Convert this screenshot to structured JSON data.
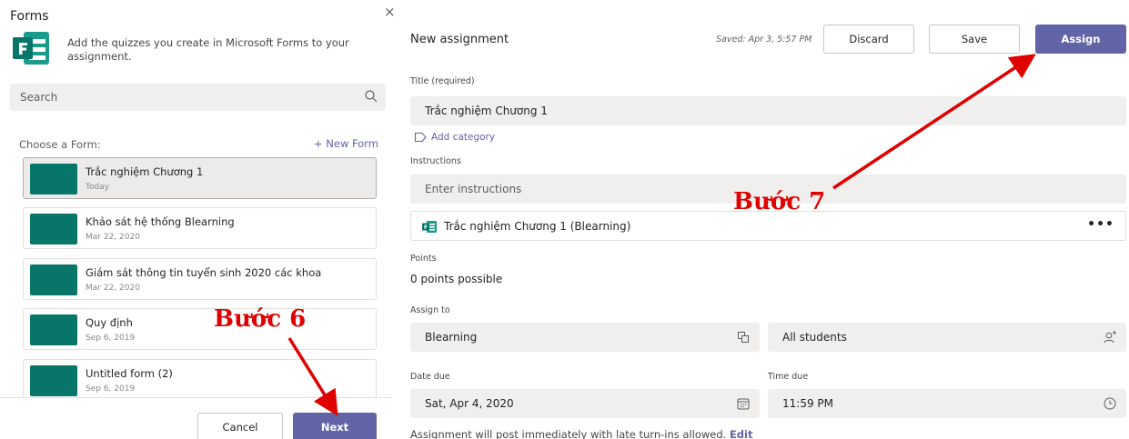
{
  "forms_panel": {
    "title": "Forms",
    "close_glyph": "×",
    "logo_icon": "microsoft-forms-icon",
    "description": "Add the quizzes you create in Microsoft Forms to your assignment.",
    "search": {
      "placeholder": "Search",
      "icon": "search-icon"
    },
    "choose_label": "Choose a Form:",
    "new_form_label": "+ New Form",
    "forms": [
      {
        "name": "Trắc nghiệm Chương 1",
        "date": "Today",
        "selected": true
      },
      {
        "name": "Khảo sát hệ thống Blearning",
        "date": "Mar 22, 2020",
        "selected": false
      },
      {
        "name": "Giám sát thông tin tuyển sinh 2020 các khoa",
        "date": "Mar 22, 2020",
        "selected": false
      },
      {
        "name": "Quy định",
        "date": "Sep 6, 2019",
        "selected": false
      },
      {
        "name": "Untitled form (2)",
        "date": "Sep 6, 2019",
        "selected": false
      }
    ],
    "cancel_label": "Cancel",
    "next_label": "Next",
    "thumb_color": "#077568"
  },
  "assignment": {
    "title": "New assignment",
    "saved_text": "Saved: Apr 3, 5:57 PM",
    "discard_label": "Discard",
    "save_label": "Save",
    "assign_label": "Assign",
    "accent_color": "#6264a7",
    "title_label": "Title (required)",
    "title_value": "Trắc nghiệm Chương 1",
    "add_category_label": "Add category",
    "instructions_label": "Instructions",
    "instructions_placeholder": "Enter instructions",
    "attachment_name": "Trắc nghiệm Chương 1 (Blearning)",
    "more_glyph": "•••",
    "points_label": "Points",
    "points_value": "0 points possible",
    "assign_to_label": "Assign to",
    "class_value": "Blearning",
    "students_value": "All students",
    "date_due_label": "Date due",
    "date_due_value": "Sat, Apr 4, 2020",
    "time_due_label": "Time due",
    "time_due_value": "11:59 PM",
    "footnote_text": "Assignment will post immediately with late turn-ins allowed.",
    "footnote_edit": "Edit"
  },
  "annotations": {
    "step6": "Bước 6",
    "step7": "Bước 7",
    "color": "#e00000"
  }
}
